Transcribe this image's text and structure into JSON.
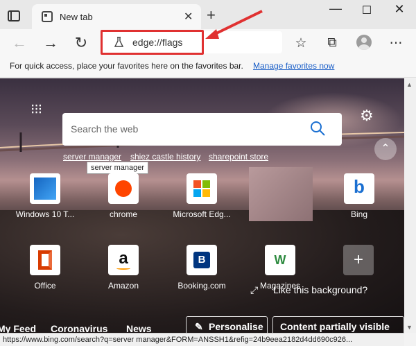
{
  "tab": {
    "title": "New tab"
  },
  "address": {
    "value": "edge://flags"
  },
  "favbar": {
    "text": "For quick access, place your favorites here on the favorites bar.",
    "link": "Manage favorites now"
  },
  "search": {
    "placeholder": "Search the web"
  },
  "quick_links": [
    "server manager",
    "shiez castle history",
    "sharepoint store"
  ],
  "tooltip": "server manager",
  "tiles": [
    {
      "label": "Windows 10 T..."
    },
    {
      "label": "chrome"
    },
    {
      "label": "Microsoft Edg..."
    },
    {
      "label": "Bing"
    },
    {
      "label": "Office"
    },
    {
      "label": "Amazon"
    },
    {
      "label": "Booking.com"
    },
    {
      "label": "Magazines"
    }
  ],
  "background_prompt": "Like this background?",
  "bottom_nav": [
    "My Feed",
    "Coronavirus",
    "News"
  ],
  "buttons": {
    "personalise": "Personalise",
    "content_visibility": "Content partially visible"
  },
  "status_url": "https://www.bing.com/search?q=server manager&FORM=ANSSH1&refig=24b9eea2182d4dd690c926..."
}
